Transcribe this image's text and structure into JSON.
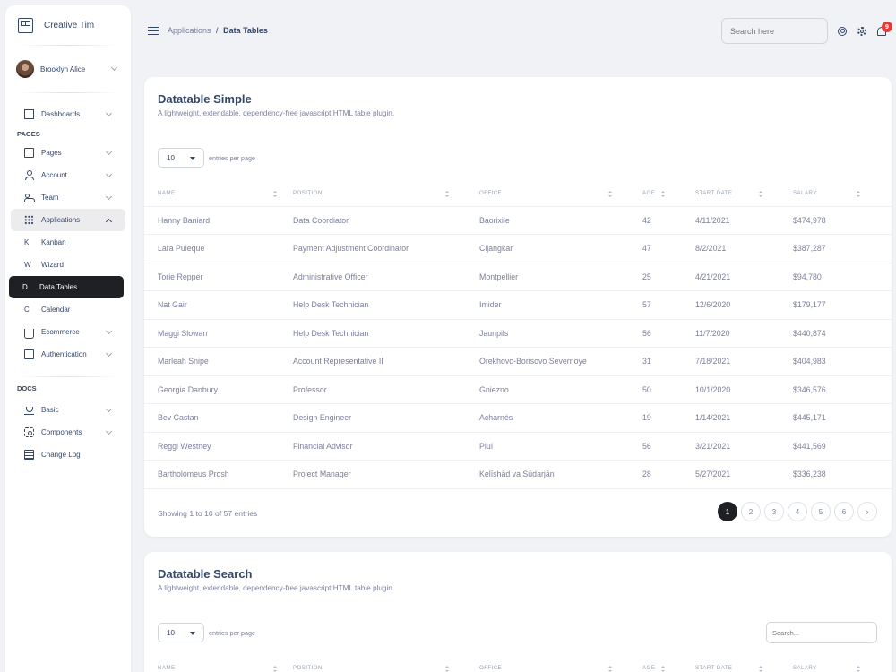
{
  "brand": {
    "name": "Creative Tim"
  },
  "user": {
    "name": "Brooklyn Alice"
  },
  "sidebar": {
    "dashboards": "Dashboards",
    "pages_title": "PAGES",
    "items": [
      {
        "label": "Pages"
      },
      {
        "label": "Account"
      },
      {
        "label": "Team"
      },
      {
        "label": "Applications"
      }
    ],
    "sub_items": [
      {
        "letter": "K",
        "label": "Kanban"
      },
      {
        "letter": "W",
        "label": "Wizard"
      },
      {
        "letter": "D",
        "label": "Data Tables"
      },
      {
        "letter": "C",
        "label": "Calendar"
      }
    ],
    "ecommerce": "Ecommerce",
    "authentication": "Authentication",
    "docs_title": "DOCS",
    "docs": [
      {
        "label": "Basic"
      },
      {
        "label": "Components"
      },
      {
        "label": "Change Log"
      }
    ]
  },
  "topbar": {
    "breadcrumb_parent": "Applications",
    "breadcrumb_sep": "/",
    "breadcrumb_current": "Data Tables",
    "search_placeholder": "Search here",
    "notifications_count": "9"
  },
  "table_common": {
    "entries_value": "10",
    "entries_label": "entries per page",
    "columns": [
      "NAME",
      "POSITION",
      "OFFICE",
      "AGE",
      "START DATE",
      "SALARY"
    ]
  },
  "card1": {
    "title": "Datatable Simple",
    "subtitle": "A lightweight, extendable, dependency-free javascript HTML table plugin.",
    "rows": [
      [
        "Hanny Baniard",
        "Data Coordiator",
        "Baorixile",
        "42",
        "4/11/2021",
        "$474,978"
      ],
      [
        "Lara Puleque",
        "Payment Adjustment Coordinator",
        "Cijangkar",
        "47",
        "8/2/2021",
        "$387,287"
      ],
      [
        "Torie Repper",
        "Administrative Officer",
        "Montpellier",
        "25",
        "4/21/2021",
        "$94,780"
      ],
      [
        "Nat Gair",
        "Help Desk Technician",
        "Imider",
        "57",
        "12/6/2020",
        "$179,177"
      ],
      [
        "Maggi Slowan",
        "Help Desk Technician",
        "Jaunpils",
        "56",
        "11/7/2020",
        "$440,874"
      ],
      [
        "Marleah Snipe",
        "Account Representative II",
        "Orekhovo-Borisovo Severnoye",
        "31",
        "7/18/2021",
        "$404,983"
      ],
      [
        "Georgia Danbury",
        "Professor",
        "Gniezno",
        "50",
        "10/1/2020",
        "$346,576"
      ],
      [
        "Bev Castan",
        "Design Engineer",
        "Acharnés",
        "19",
        "1/14/2021",
        "$445,171"
      ],
      [
        "Reggi Westney",
        "Financial Advisor",
        "Piuí",
        "56",
        "3/21/2021",
        "$441,569"
      ],
      [
        "Bartholomeus Prosh",
        "Project Manager",
        "Kelīshād va Sūdarjān",
        "28",
        "5/27/2021",
        "$336,238"
      ]
    ],
    "showing": "Showing 1 to 10 of 57 entries",
    "pages": [
      "1",
      "2",
      "3",
      "4",
      "5",
      "6"
    ],
    "next": "›"
  },
  "card2": {
    "title": "Datatable Search",
    "subtitle": "A lightweight, extendable, dependency-free javascript HTML table plugin.",
    "search_placeholder": "Search..."
  }
}
